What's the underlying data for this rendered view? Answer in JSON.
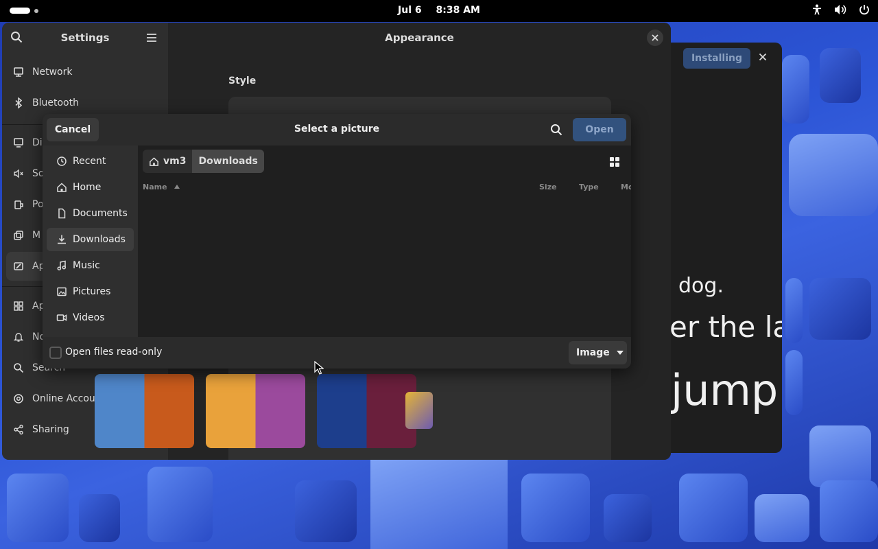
{
  "topbar": {
    "date": "Jul 6",
    "time": "8:38 AM",
    "icons": [
      "activities-indicator",
      "accessibility-icon",
      "volume-icon",
      "power-icon"
    ]
  },
  "settings": {
    "sidebar_title": "Settings",
    "page_title": "Appearance",
    "section_style": "Style",
    "items": [
      {
        "label": "Network",
        "icon": "network-icon"
      },
      {
        "label": "Bluetooth",
        "icon": "bluetooth-icon"
      },
      {
        "label": "Di",
        "icon": "display-icon"
      },
      {
        "label": "So",
        "icon": "sound-icon"
      },
      {
        "label": "Po",
        "icon": "power-icon"
      },
      {
        "label": "M",
        "icon": "multitasking-icon"
      },
      {
        "label": "Ap",
        "icon": "appearance-icon"
      },
      {
        "label": "Ap",
        "icon": "apps-icon"
      },
      {
        "label": "No",
        "icon": "notifications-icon"
      },
      {
        "label": "Search",
        "icon": "search-icon"
      },
      {
        "label": "Online Accounts",
        "icon": "online-accounts-icon"
      },
      {
        "label": "Sharing",
        "icon": "sharing-icon"
      }
    ]
  },
  "editor": {
    "installing_label": "Installing",
    "lines": [
      "dog.",
      "er the la",
      "jump"
    ]
  },
  "dialog": {
    "cancel_label": "Cancel",
    "title": "Select a picture",
    "open_label": "Open",
    "places": [
      {
        "label": "Recent",
        "icon": "clock-icon"
      },
      {
        "label": "Home",
        "icon": "home-icon"
      },
      {
        "label": "Documents",
        "icon": "document-icon"
      },
      {
        "label": "Downloads",
        "icon": "download-icon",
        "active": true
      },
      {
        "label": "Music",
        "icon": "music-icon"
      },
      {
        "label": "Pictures",
        "icon": "picture-icon"
      },
      {
        "label": "Videos",
        "icon": "video-icon"
      }
    ],
    "breadcrumb": {
      "home": "vm3",
      "current": "Downloads"
    },
    "columns": {
      "name": "Name",
      "size": "Size",
      "type": "Type",
      "modified": "Modified"
    },
    "readonly_label": "Open files read-only",
    "filter_label": "Image"
  },
  "colors": {
    "accent": "#32527e",
    "window_bg": "#242424",
    "sidebar_bg": "#2e2e2e"
  }
}
